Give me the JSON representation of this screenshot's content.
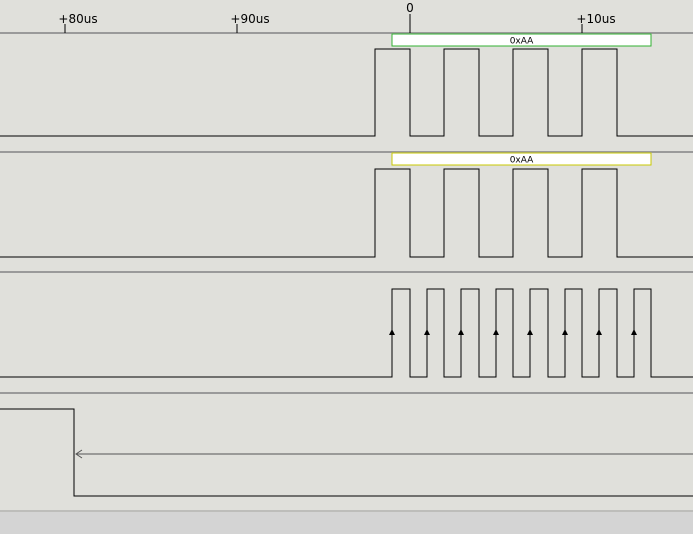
{
  "app": {
    "background_color": "#e0e0db",
    "trace_color": "#000000",
    "separator_color": "#9a9a9a",
    "status_bar_color": "#d4d4d4"
  },
  "ruler": {
    "ticks": [
      {
        "label": "+80us",
        "time_us": -20
      },
      {
        "label": "+90us",
        "time_us": -10
      },
      {
        "label": "0",
        "time_us": 0
      },
      {
        "label": "+10us",
        "time_us": 10
      }
    ]
  },
  "channels": [
    {
      "id": "ch0",
      "waveform": "data",
      "annotation": {
        "text": "0xAA",
        "border_color": "#30b030"
      }
    },
    {
      "id": "ch1",
      "waveform": "data",
      "annotation": {
        "text": "0xAA",
        "border_color": "#c8c800"
      }
    },
    {
      "id": "ch2",
      "waveform": "clock",
      "edge_markers": "rising-edge-arrow-icon",
      "pulse_count": 8
    },
    {
      "id": "ch3",
      "waveform": "trigger",
      "marker": "left-arrow-icon"
    }
  ]
}
